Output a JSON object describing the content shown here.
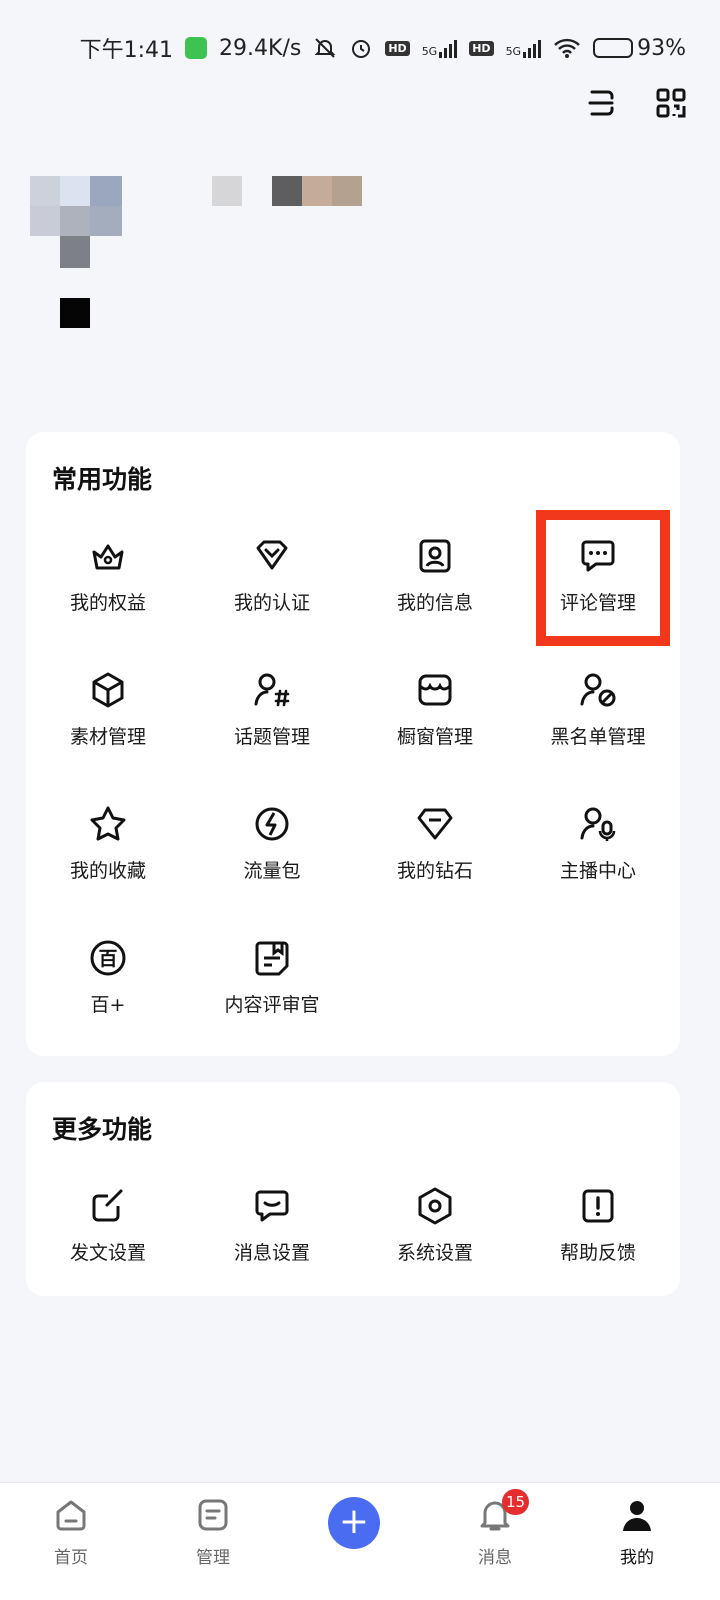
{
  "status_bar": {
    "time": "下午1:41",
    "speed": "29.4K/s",
    "hd1": "HD",
    "net1": "5G",
    "hd2": "HD",
    "net2": "5G",
    "battery": "93%",
    "battery_level": 0.93
  },
  "common": {
    "title": "常用功能",
    "items": [
      {
        "label": "我的权益",
        "icon": "crown-basket-icon"
      },
      {
        "label": "我的认证",
        "icon": "shield-v-icon"
      },
      {
        "label": "我的信息",
        "icon": "id-card-icon"
      },
      {
        "label": "评论管理",
        "icon": "comment-icon"
      },
      {
        "label": "素材管理",
        "icon": "cube-icon"
      },
      {
        "label": "话题管理",
        "icon": "user-hash-icon"
      },
      {
        "label": "橱窗管理",
        "icon": "store-icon"
      },
      {
        "label": "黑名单管理",
        "icon": "user-block-icon"
      },
      {
        "label": "我的收藏",
        "icon": "star-icon"
      },
      {
        "label": "流量包",
        "icon": "lightning-icon"
      },
      {
        "label": "我的钻石",
        "icon": "diamond-icon"
      },
      {
        "label": "主播中心",
        "icon": "user-mic-icon"
      },
      {
        "label": "百+",
        "icon": "bai-icon",
        "glyph": "百"
      },
      {
        "label": "内容评审官",
        "icon": "review-icon"
      }
    ]
  },
  "more": {
    "title": "更多功能",
    "items": [
      {
        "label": "发文设置",
        "icon": "edit-icon"
      },
      {
        "label": "消息设置",
        "icon": "message-icon"
      },
      {
        "label": "系统设置",
        "icon": "hexagon-settings-icon"
      },
      {
        "label": "帮助反馈",
        "icon": "exclamation-icon"
      }
    ]
  },
  "bottom_nav": {
    "items": [
      {
        "label": "首页",
        "icon": "home-icon"
      },
      {
        "label": "管理",
        "icon": "manage-icon"
      },
      {
        "label": "消息",
        "icon": "bell-icon",
        "badge": "15"
      },
      {
        "label": "我的",
        "icon": "profile-icon"
      }
    ],
    "plus": "+"
  },
  "colors": {
    "accent": "#4a6cf0",
    "highlight": "#f2381c",
    "badge": "#e52d2d"
  }
}
